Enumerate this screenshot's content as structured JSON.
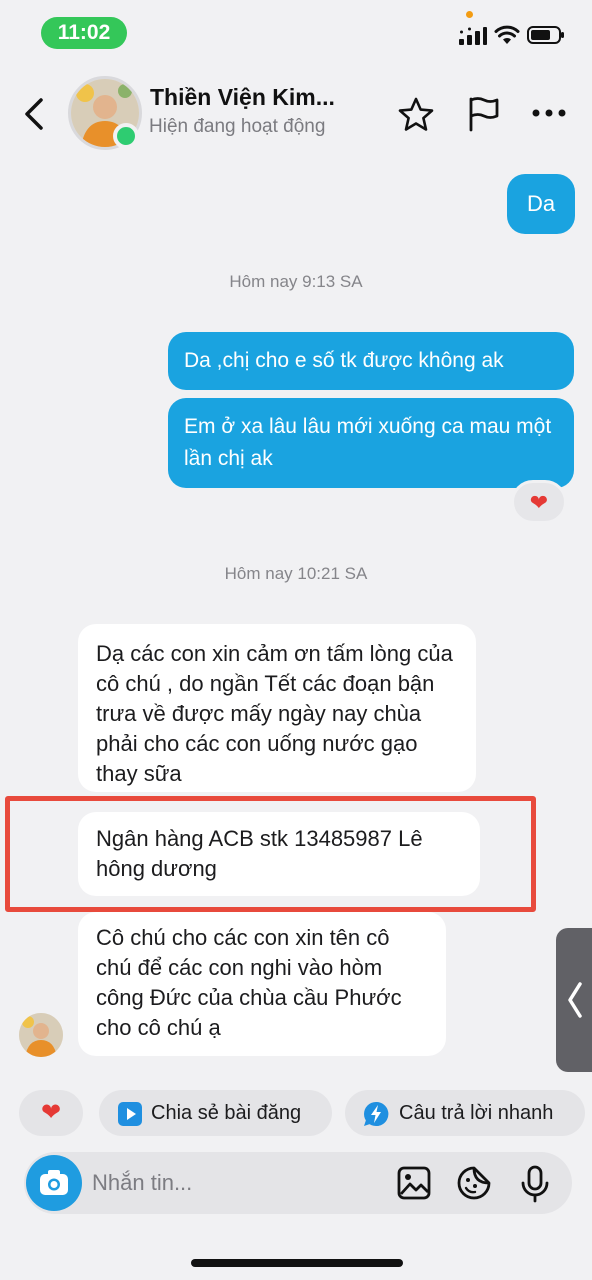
{
  "status_bar": {
    "time": "11:02"
  },
  "header": {
    "contact_name": "Thiền Viện Kim...",
    "status": "Hiện đang hoạt động",
    "icons": [
      "back-icon",
      "star-icon",
      "flag-icon",
      "more-icon"
    ]
  },
  "messages": {
    "out_1": "Da",
    "timestamp_1": "Hôm nay 9:13 SA",
    "out_2": "Da ,chị cho e số tk được không ak",
    "out_3": "Em ở xa lâu lâu mới xuống ca mau một lần chị ak",
    "reaction": "❤",
    "timestamp_2": "Hôm nay 10:21 SA",
    "in_1": "Dạ các con xin cảm ơn tấm lòng của cô chú , do ngần Tết các đoạn bận trưa về được mấy ngày nay chùa phải cho các con uống nước gạo thay sữa",
    "in_2": "Ngân hàng ACB stk 13485987 Lê hông dương",
    "in_3": "Cô chú cho các con xin tên cô chú để các con nghi vào hòm công Đức của chùa cầu Phước cho cô chú ạ"
  },
  "quick_actions": {
    "heart": "❤",
    "share": "Chia sẻ bài đăng",
    "reply": "Câu trả lời nhanh"
  },
  "composer": {
    "placeholder": "Nhắn tin..."
  },
  "colors": {
    "outgoing_bubble": "#1aa3e0",
    "online": "#2ecc71",
    "highlight": "#e84a3c",
    "time_pill": "#34c759"
  }
}
